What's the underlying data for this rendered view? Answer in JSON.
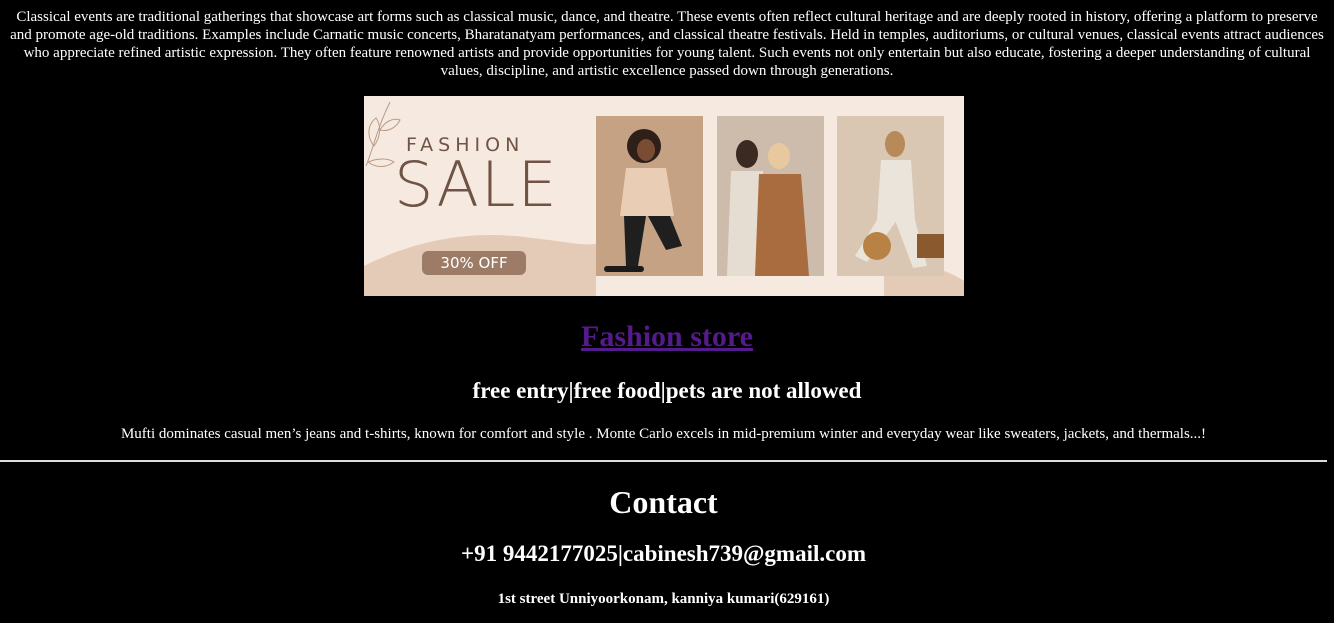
{
  "intro": {
    "text": "Classical events are traditional gatherings that showcase art forms such as classical music, dance, and theatre. These events often reflect cultural heritage and are deeply rooted in history, offering a platform to preserve and promote age-old traditions. Examples include Carnatic music concerts, Bharatanatyam performances, and classical theatre festivals. Held in temples, auditoriums, or cultural venues, classical events attract audiences who appreciate refined artistic expression. They often feature renowned artists and provide opportunities for young talent. Such events not only entertain but also educate, fostering a deeper understanding of cultural values, discipline, and artistic excellence passed down through generations."
  },
  "banner": {
    "fashion": "FASHION",
    "sale": "SALE",
    "discount": "30% OFF",
    "colors": {
      "background": "#f6e9df",
      "wave": "#e3cbb8",
      "text": "#6f5446",
      "pill": "#9d7c67"
    }
  },
  "store": {
    "title": "Fashion store",
    "link_color": "#551a8b"
  },
  "tagline": "free entry|free food|pets are not allowed",
  "description": "Mufti dominates casual men’s jeans and t-shirts, known for comfort and style . Monte Carlo excels in mid-premium winter and everyday wear like sweaters, jackets, and thermals...!",
  "contact": {
    "title": "Contact",
    "phone_email": "+91 9442177025|cabinesh739@gmail.com",
    "address": "1st street Unniyoorkonam, kanniya kumari(629161)"
  }
}
